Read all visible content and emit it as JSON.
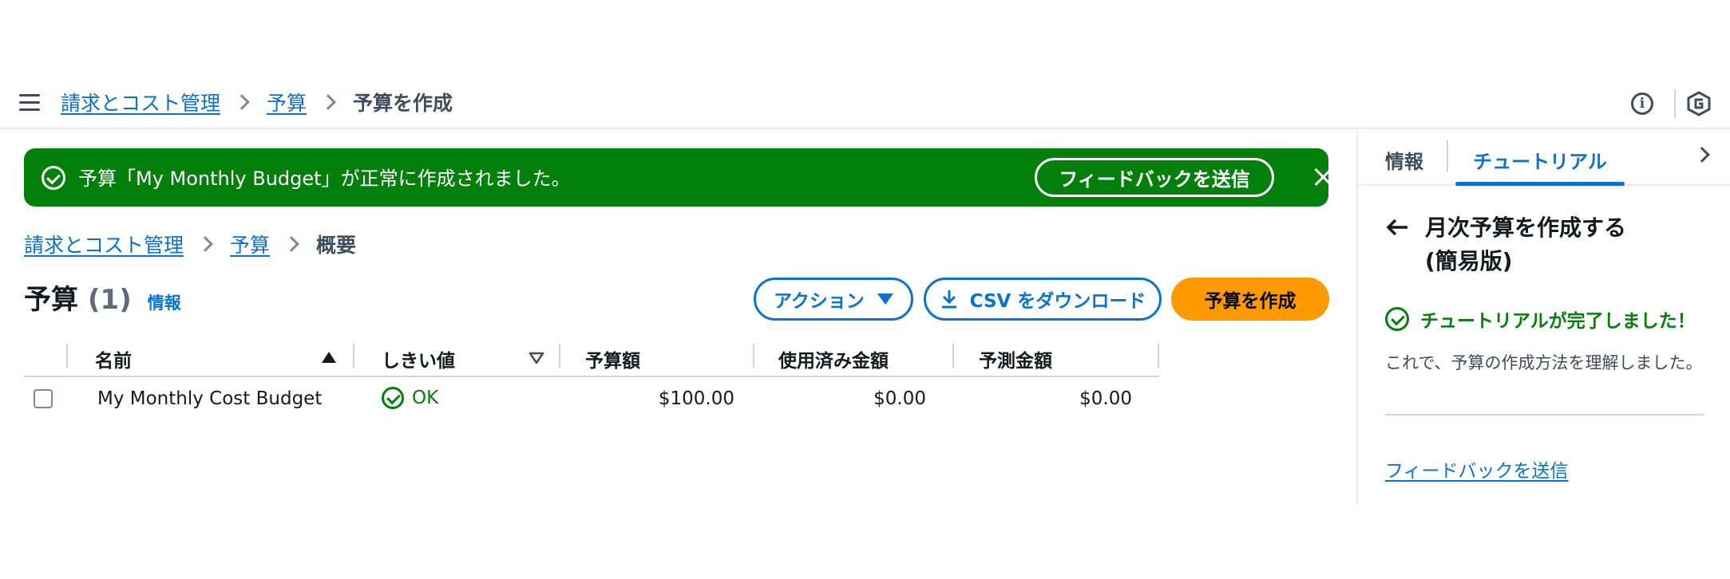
{
  "top_breadcrumb": {
    "items": [
      "請求とコスト管理",
      "予算"
    ],
    "current": "予算を作成"
  },
  "flash": {
    "message": "予算「My Monthly Budget」が正常に作成されました。",
    "feedback_label": "フィードバックを送信",
    "color": "#037f0c"
  },
  "inner_breadcrumb": {
    "items": [
      "請求とコスト管理",
      "予算"
    ],
    "current": "概要"
  },
  "header": {
    "title": "予算",
    "count": "(1)",
    "info_label": "情報"
  },
  "buttons": {
    "actions": "アクション",
    "csv": "CSV をダウンロード",
    "create": "予算を作成"
  },
  "table": {
    "columns": [
      "名前",
      "しきい値",
      "予算額",
      "使用済み金額",
      "予測金額"
    ],
    "rows": [
      {
        "name": "My Monthly Cost Budget",
        "threshold": "OK",
        "budget": "$100.00",
        "used": "$0.00",
        "forecast": "$0.00"
      }
    ]
  },
  "panel": {
    "tabs": [
      "情報",
      "チュートリアル"
    ],
    "active_tab": "チュートリアル",
    "title_line1": "月次予算を作成する",
    "title_line2": "(簡易版)",
    "done_text": "チュートリアルが完了しました！",
    "description": "これで、予算の作成方法を理解しました。",
    "feedback_link": "フィードバックを送信"
  },
  "colors": {
    "link": "#0972d3",
    "primary_button": "#ff9900",
    "success": "#037f0c"
  },
  "icons": [
    "menu-icon",
    "info-icon",
    "hexagon-icon",
    "check-circle-icon",
    "close-icon",
    "caret-down-icon",
    "download-icon",
    "sort-ascending-icon",
    "sort-descending-icon",
    "arrow-left-icon",
    "chevron-right-icon"
  ]
}
